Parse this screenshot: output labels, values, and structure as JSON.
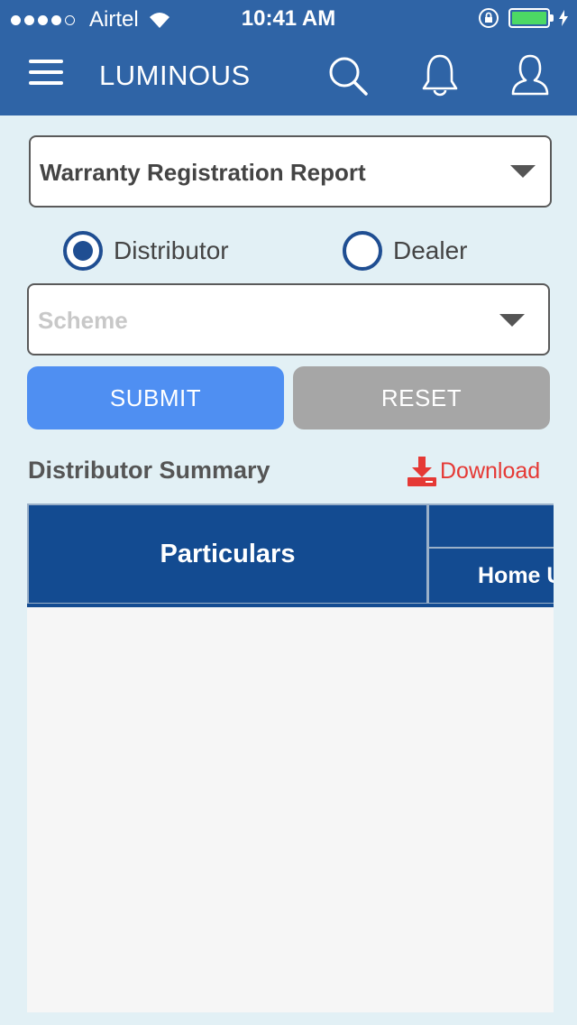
{
  "status_bar": {
    "carrier": "Airtel",
    "time": "10:41 AM"
  },
  "navbar": {
    "title": "LUMINOUS",
    "icons": [
      "menu-icon",
      "search-icon",
      "bell-icon",
      "user-icon"
    ]
  },
  "report_select": {
    "value": "Warranty Registration Report"
  },
  "role_radio": {
    "options": [
      "Distributor",
      "Dealer"
    ],
    "selected": "Distributor"
  },
  "scheme_select": {
    "placeholder": "Scheme"
  },
  "buttons": {
    "submit": "SUBMIT",
    "reset": "RESET"
  },
  "summary": {
    "title": "Distributor Summary",
    "download_label": "Download"
  },
  "table": {
    "headers": [
      "Particulars",
      "Home U"
    ]
  },
  "colors": {
    "primary": "#2f64a6",
    "header_dark": "#134b91",
    "submit": "#4f8ff2",
    "reset": "#a6a6a6",
    "download": "#e53935",
    "background": "#e2f0f5"
  }
}
